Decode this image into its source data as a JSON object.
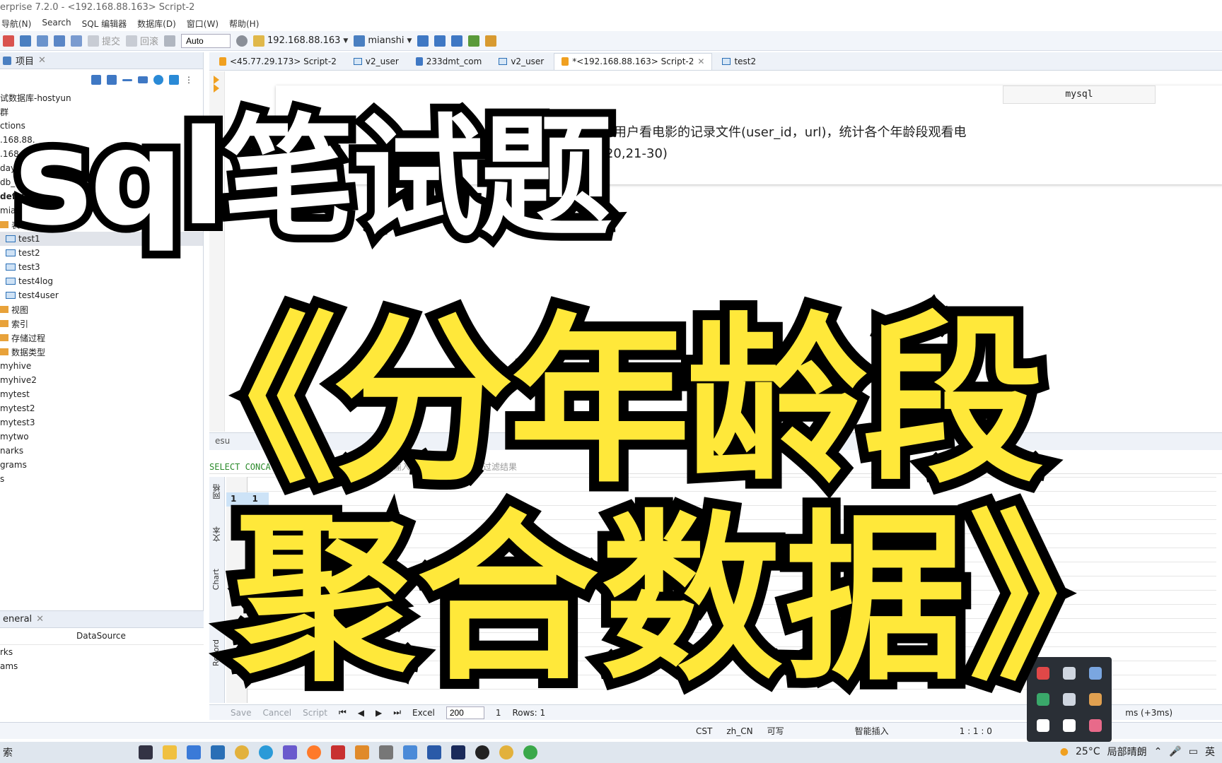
{
  "window": {
    "title": "erprise 7.2.0 - <192.168.88.163> Script-2"
  },
  "menu": [
    "导航(N)",
    "Search",
    "SQL 编辑器",
    "数据库(D)",
    "窗口(W)",
    "帮助(H)"
  ],
  "toolbar": {
    "commit_label": "提交",
    "rollback_label": "回滚",
    "mode_value": "Auto",
    "connection": "192.168.88.163",
    "database": "mianshi"
  },
  "project_panel": {
    "title": "项目",
    "tree": [
      "试数据库-hostyun",
      "群",
      "ctions",
      ".168.88.",
      ".168.88.",
      "day03_h",
      "db_hive",
      "default",
      "mianshi",
      "表",
      "test1",
      "test2",
      "test3",
      "test4log",
      "test4user",
      "视图",
      "索引",
      "存储过程",
      "数据类型",
      "myhive",
      "myhive2",
      "mytest",
      "mytest2",
      "mytest3",
      "mytwo",
      "narks",
      "grams",
      "s"
    ]
  },
  "general_panel": {
    "title": "eneral",
    "column": "DataSource",
    "rows": [
      "rks",
      "ams"
    ]
  },
  "editor_tabs": [
    {
      "label": "<45.77.29.173> Script-2"
    },
    {
      "label": "v2_user"
    },
    {
      "label": "233dmt_com"
    },
    {
      "label": "v2_user"
    },
    {
      "label": "*<192.168.88.163> Script-2"
    },
    {
      "label": "test2"
    }
  ],
  "hint": {
    "tag": "mysql",
    "line1": "age)，一个2亿记录的用户看电影的记录文件(user_id，url)，统计各个年龄段观看电",
    "line2": "段，比如：0-10,11-20,21-30)"
  },
  "results": {
    "header": "esu",
    "filter_sql": "SELECT CONCAT('123','234','345')",
    "filter_placeholder": "输入一个 SQL 表达式来过滤结果",
    "side_tabs": [
      "网格",
      "文本",
      "Chart",
      "Record"
    ],
    "row_number": "1",
    "cell_value": "1"
  },
  "status": {
    "save": "Save",
    "cancel": "Cancel",
    "script": "Script",
    "excel": "Excel",
    "fetch_size": "200",
    "refresh_count": "1",
    "rows": "Rows: 1",
    "timing": "ms (+3ms)"
  },
  "bottom_bar": {
    "tz": "CST",
    "locale": "zh_CN",
    "writable": "可写",
    "insert_mode": "智能插入",
    "position": "1 : 1 : 0"
  },
  "taskbar": {
    "start_label": "索",
    "weather": "25°C",
    "weather_desc": "局部晴朗",
    "ime": "英"
  },
  "overlay": {
    "line1": "sql笔试题",
    "line2": "《分年龄段",
    "line3": "聚合数据》"
  },
  "colors": {
    "overlay_yellow": "#ffe83a",
    "overlay_stroke": "#000000",
    "accent": "#2a6fb6"
  }
}
